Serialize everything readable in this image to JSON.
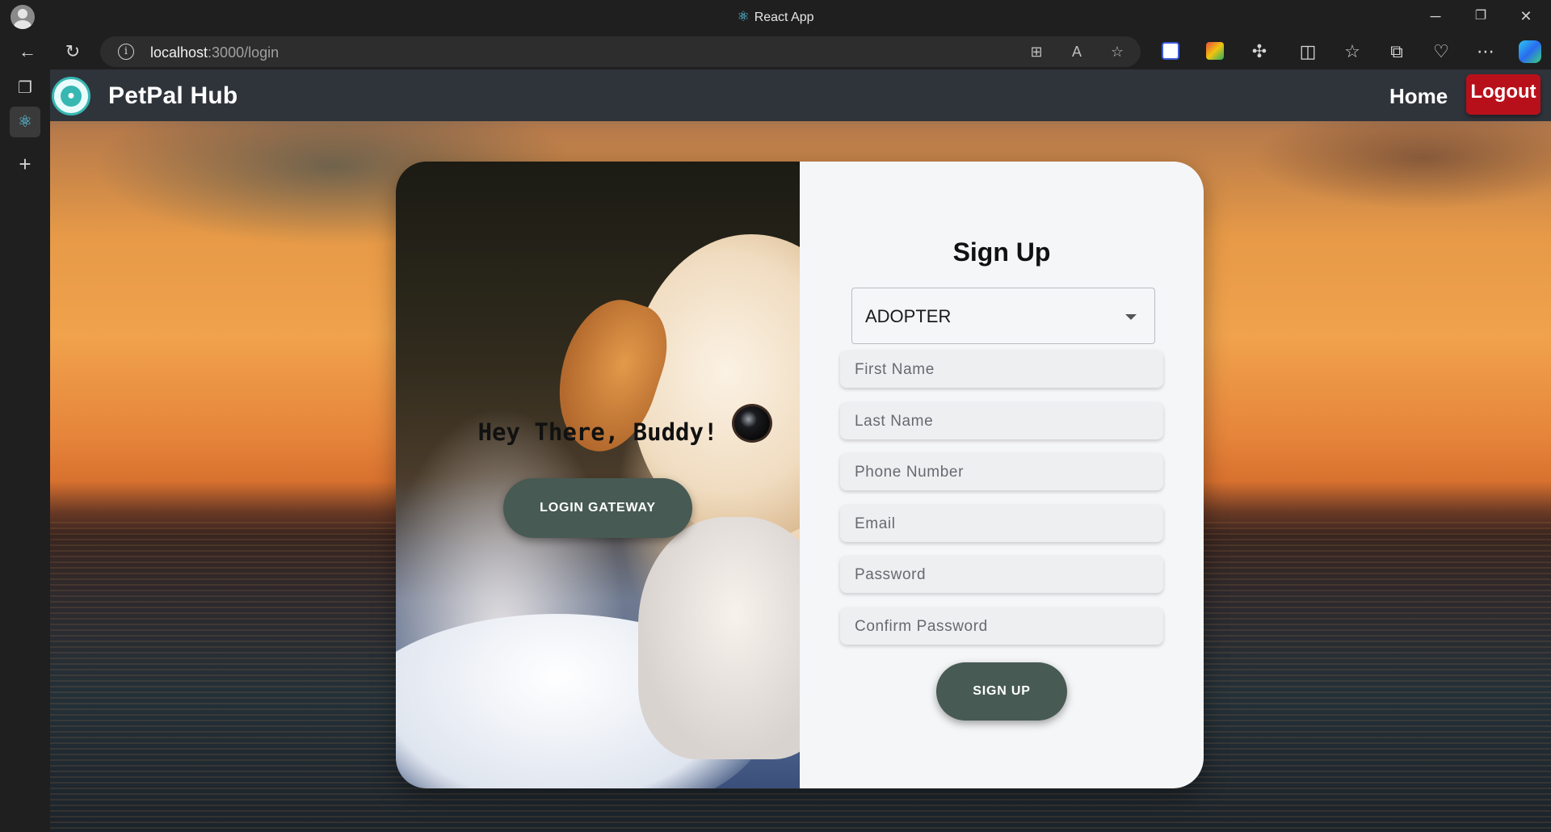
{
  "browser": {
    "window_title": "React App",
    "url_host": "localhost",
    "url_rest": ":3000/login",
    "controls": {
      "minimize": "─",
      "restore": "❐",
      "close": "✕"
    }
  },
  "navbar": {
    "brand": "PetPal Hub",
    "home": "Home",
    "logout": "Logout",
    "colors": {
      "background": "#2f343b",
      "logout": "#b8101b",
      "logo": "#36b7b2"
    }
  },
  "left_panel": {
    "greeting": "Hey There, Buddy!",
    "gateway_button": "LOGIN GATEWAY"
  },
  "signup": {
    "title": "Sign Up",
    "role_select": {
      "value": "ADOPTER"
    },
    "fields": [
      {
        "placeholder": "First Name"
      },
      {
        "placeholder": "Last Name"
      },
      {
        "placeholder": "Phone Number"
      },
      {
        "placeholder": "Email"
      },
      {
        "placeholder": "Password"
      },
      {
        "placeholder": "Confirm Password"
      }
    ],
    "submit": "SIGN UP",
    "colors": {
      "button": "#475a53",
      "panel": "#f5f6f8"
    }
  }
}
